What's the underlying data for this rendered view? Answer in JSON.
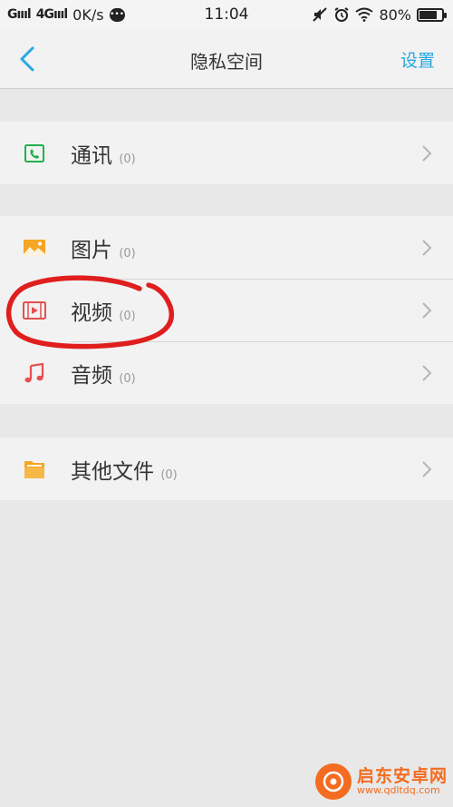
{
  "status_bar": {
    "signal1": "G",
    "signal2": "4G",
    "speed": "0K/s",
    "time": "11:04",
    "battery": "80%",
    "battery_level": 0.8
  },
  "header": {
    "title": "隐私空间",
    "settings_label": "设置"
  },
  "groups": [
    {
      "items": [
        {
          "label": "通讯",
          "count": "(0)",
          "icon": "contacts-icon",
          "color": "#22b14c"
        }
      ]
    },
    {
      "items": [
        {
          "label": "图片",
          "count": "(0)",
          "icon": "picture-icon",
          "color": "#f5a623"
        },
        {
          "label": "视频",
          "count": "(0)",
          "icon": "video-icon",
          "color": "#e55050"
        },
        {
          "label": "音频",
          "count": "(0)",
          "icon": "music-icon",
          "color": "#e55050"
        }
      ]
    },
    {
      "items": [
        {
          "label": "其他文件",
          "count": "(0)",
          "icon": "folder-icon",
          "color": "#f5a623"
        }
      ]
    }
  ],
  "watermark": {
    "name": "启东安卓网",
    "url": "www.qdltdq.com"
  },
  "colors": {
    "accent": "#29a8e0",
    "annotation": "#e01e1e",
    "background": "#e8e8e8"
  }
}
